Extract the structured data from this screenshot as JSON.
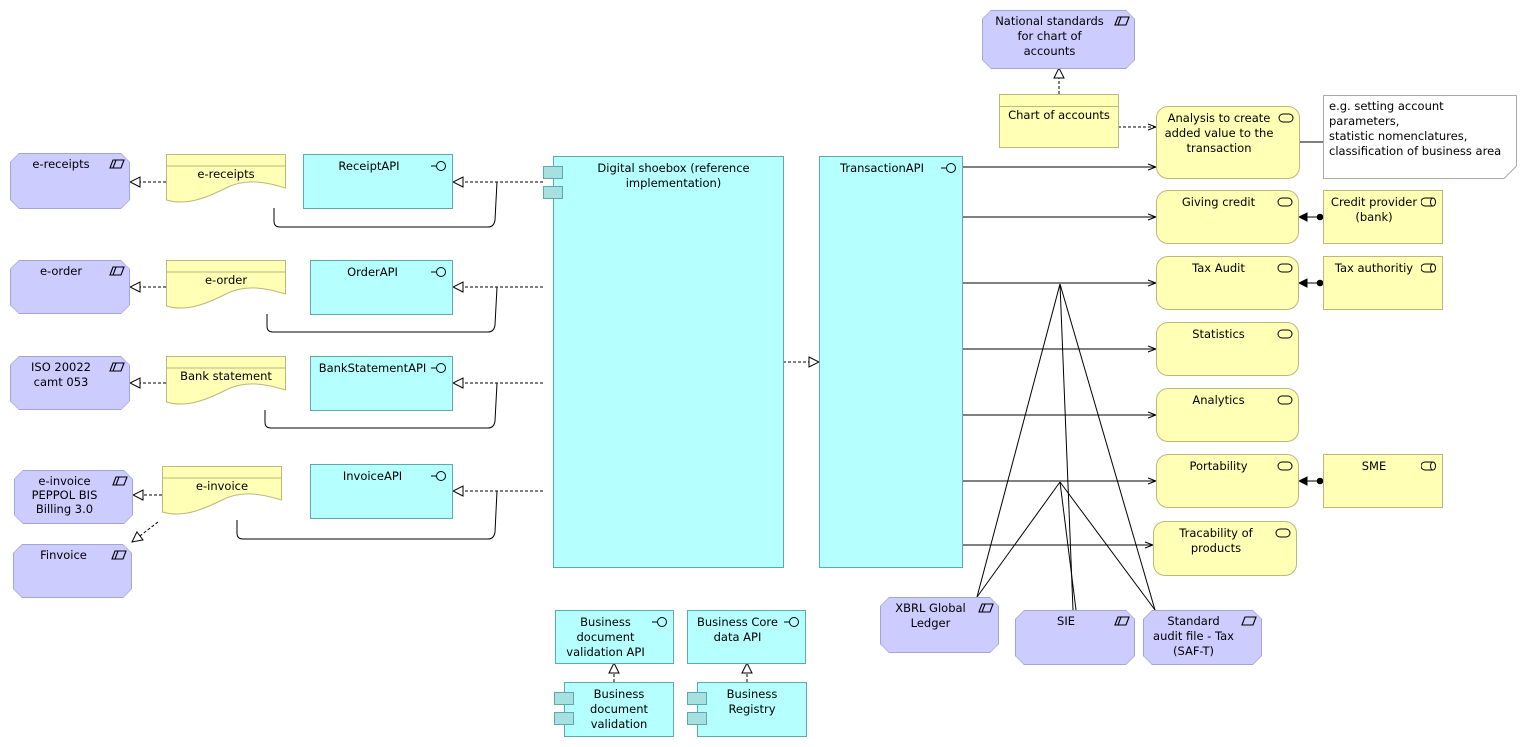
{
  "diagram": {
    "colors": {
      "motivation": "#ccccff",
      "application": "#b5ffff",
      "business": "#ffffb5",
      "note": "#ffffff"
    },
    "left_constraints": [
      {
        "label": "e-receipts",
        "icon": "constraint-icon"
      },
      {
        "label": "e-order",
        "icon": "constraint-icon"
      },
      {
        "label": "ISO 20022\ncamt 053",
        "icon": "constraint-icon"
      },
      {
        "label": "e-invoice\nPEPPOL BIS\nBilling 3.0",
        "icon": "constraint-icon"
      },
      {
        "label": "Finvoice",
        "icon": "constraint-icon"
      }
    ],
    "representations": [
      {
        "label": "e-receipts"
      },
      {
        "label": "e-order"
      },
      {
        "label": "Bank statement"
      },
      {
        "label": "e-invoice"
      }
    ],
    "interfaces": [
      {
        "label": "ReceiptAPI",
        "icon": "interface-icon"
      },
      {
        "label": "OrderAPI",
        "icon": "interface-icon"
      },
      {
        "label": "BankStatementAPI",
        "icon": "interface-icon"
      },
      {
        "label": "InvoiceAPI",
        "icon": "interface-icon"
      }
    ],
    "shoebox": {
      "label": "Digital shoebox (reference\nimplementation)",
      "icon": "component-icon"
    },
    "transaction_api": {
      "label": "TransactionAPI",
      "icon": "interface-icon"
    },
    "bottom_apis": [
      {
        "label": "Business\ndocument\nvalidation API",
        "icon": "interface-icon"
      },
      {
        "label": "Business Core\ndata API",
        "icon": "interface-icon"
      }
    ],
    "bottom_components": [
      {
        "label": "Business\ndocument\nvalidation",
        "icon": "component-icon"
      },
      {
        "label": "Business Registry",
        "icon": "component-icon"
      }
    ],
    "national_standards": {
      "label": "National standards\nfor chart of\naccounts",
      "icon": "constraint-icon"
    },
    "chart_of_accounts": {
      "label": "Chart of accounts"
    },
    "services": [
      {
        "label": "Analysis to create\nadded value to the\ntransaction",
        "icon": "service-icon"
      },
      {
        "label": "Giving credit",
        "icon": "service-icon"
      },
      {
        "label": "Tax Audit",
        "icon": "service-icon"
      },
      {
        "label": "Statistics",
        "icon": "service-icon"
      },
      {
        "label": "Analytics",
        "icon": "service-icon"
      },
      {
        "label": "Portability",
        "icon": "service-icon"
      },
      {
        "label": "Tracability of\nproducts",
        "icon": "service-icon"
      }
    ],
    "roles": [
      {
        "label": "Credit provider\n(bank)",
        "icon": "role-icon"
      },
      {
        "label": "Tax authoritiy",
        "icon": "role-icon"
      },
      {
        "label": "SME",
        "icon": "role-icon"
      }
    ],
    "note": {
      "label": "e.g. setting account parameters,\nstatistic nomenclatures,\nclassification of business area"
    },
    "standards": [
      {
        "label": "XBRL Global\nLedger",
        "icon": "constraint-icon"
      },
      {
        "label": "SIE",
        "icon": "constraint-icon"
      },
      {
        "label": "Standard\naudit file - Tax\n(SAF-T)",
        "icon": "requirement-icon"
      }
    ]
  }
}
